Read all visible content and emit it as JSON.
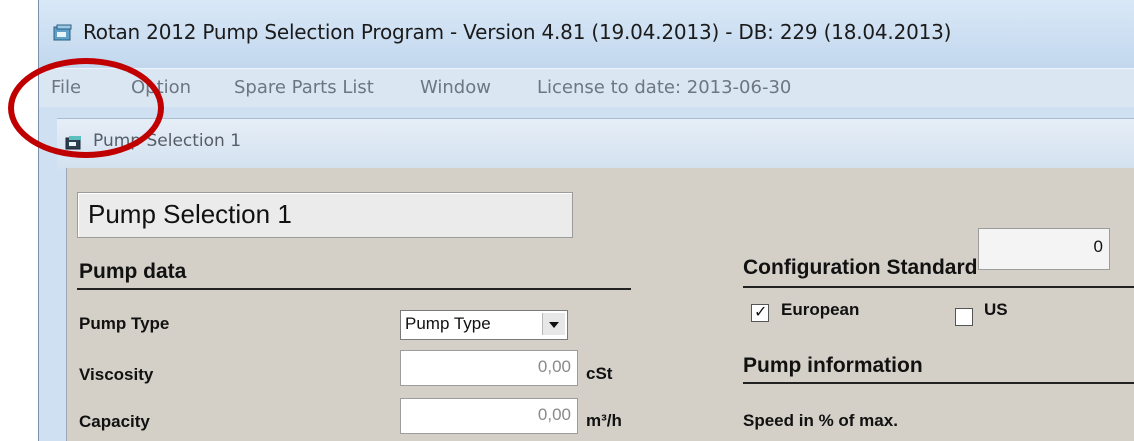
{
  "window": {
    "title": "Rotan 2012 Pump Selection Program - Version 4.81 (19.04.2013) - DB: 229 (18.04.2013)",
    "icon": "app-icon"
  },
  "menu": {
    "file": "File",
    "option": "Option",
    "spare_parts": "Spare Parts List",
    "window": "Window",
    "license": "License to date: 2013-06-30"
  },
  "child": {
    "title": "Pump Selection 1",
    "icon": "document-icon"
  },
  "form": {
    "selection_name": "Pump Selection 1",
    "pump_data": {
      "title": "Pump data",
      "pump_type_label": "Pump Type",
      "pump_type_value": "Pump Type",
      "viscosity_label": "Viscosity",
      "viscosity_value": "0,00",
      "viscosity_unit": "cSt",
      "capacity_label": "Capacity",
      "capacity_value": "0,00",
      "capacity_unit": "m³/h"
    },
    "config": {
      "title": "Configuration Standard",
      "european_label": "European",
      "european_checked": true,
      "us_label": "US",
      "us_checked": false
    },
    "pump_info": {
      "title": "Pump information",
      "speed_label": "Speed in % of max.",
      "speed_value": "0"
    }
  },
  "annotation": {
    "color": "#c00000",
    "shape": "circle-highlight"
  }
}
